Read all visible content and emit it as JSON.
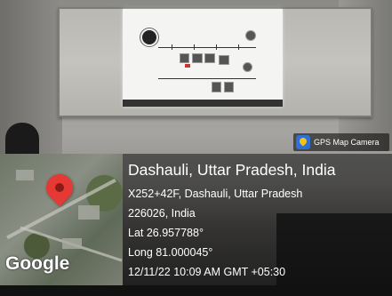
{
  "watermark": {
    "label": "GPS Map Camera",
    "logo_icon": "gps-map-camera-logo",
    "accent": "#2f6fd6"
  },
  "map": {
    "brand": "Google",
    "pin_icon": "map-pin-icon",
    "pin_color": "#e53935"
  },
  "location": {
    "title": "Dashauli, Uttar Pradesh, India",
    "address_line1": "X252+42F, Dashauli, Uttar Pradesh",
    "address_line2": "226026, India",
    "lat": "Lat 26.957788°",
    "long": "Long 81.000045°",
    "datetime": "12/11/22 10:09 AM GMT +05:30"
  }
}
